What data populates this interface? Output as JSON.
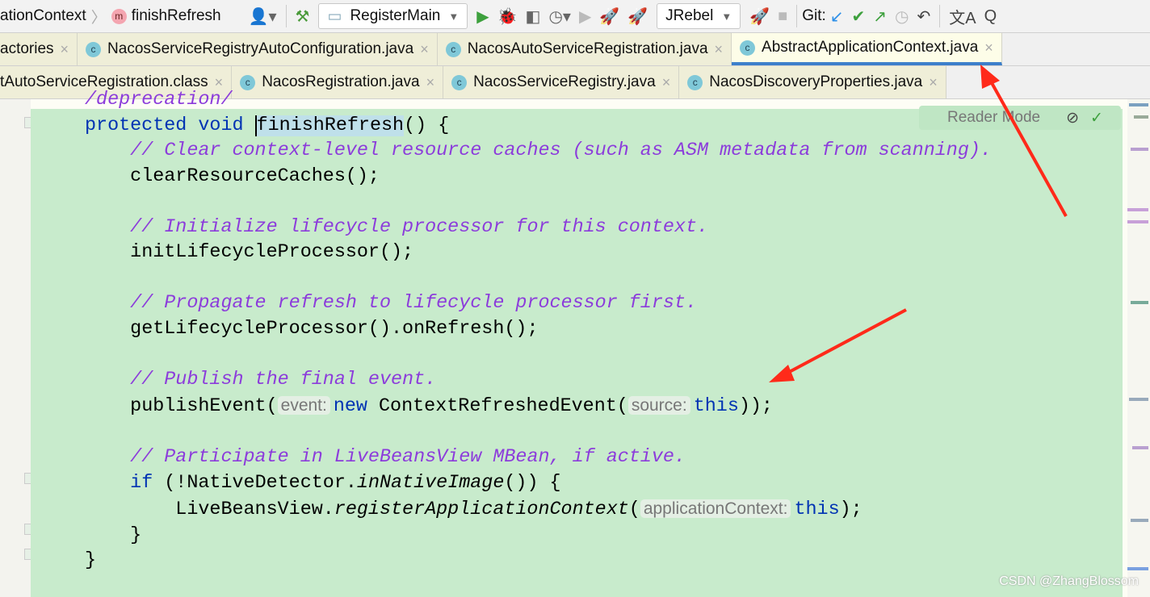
{
  "toolbar": {
    "breadcrumb_class": "ationContext",
    "breadcrumb_method": "finishRefresh",
    "method_icon_letter": "m",
    "run_config": "RegisterMain",
    "jrebel_config": "JRebel",
    "git_label": "Git:"
  },
  "tabs_row1": [
    {
      "label": "actories"
    },
    {
      "label": "NacosServiceRegistryAutoConfiguration.java"
    },
    {
      "label": "NacosAutoServiceRegistration.java"
    },
    {
      "label": "AbstractApplicationContext.java",
      "active": true
    }
  ],
  "tabs_row2": [
    {
      "label": "tAutoServiceRegistration.class"
    },
    {
      "label": "NacosRegistration.java"
    },
    {
      "label": "NacosServiceRegistry.java"
    },
    {
      "label": "NacosDiscoveryProperties.java"
    }
  ],
  "editor": {
    "reader_mode": "Reader Mode",
    "partial_line": "/deprecation/",
    "kw_protected": "protected",
    "kw_void": "void",
    "method_name": "finishRefresh",
    "sig_rest": "() {",
    "c1": "// Clear context-level resource caches (such as ASM metadata from scanning).",
    "l1": "clearResourceCaches();",
    "c2": "// Initialize lifecycle processor for this context.",
    "l2": "initLifecycleProcessor();",
    "c3": "// Propagate refresh to lifecycle processor first.",
    "l3": "getLifecycleProcessor().onRefresh();",
    "c4": "// Publish the final event.",
    "l4a": "publishEvent(",
    "hint_event": "event:",
    "kw_new": "new",
    "l4b": " ContextRefreshedEvent(",
    "hint_source": "source:",
    "kw_this": "this",
    "l4c": "));",
    "c5": "// Participate in LiveBeansView MBean, if active.",
    "kw_if": "if",
    "l5a": " (!NativeDetector.",
    "l5b": "inNativeImage",
    "l5c": "()) {",
    "l6a": "LiveBeansView.",
    "l6b": "registerApplicationContext",
    "l6c": "(",
    "hint_ctx": "applicationContext:",
    "l6d": ");",
    "close_inner": "}",
    "close_outer": "}"
  },
  "watermark": "CSDN @ZhangBlossom",
  "colors": {
    "accent": "#3d7fcb",
    "keyword": "#0033b3",
    "comment": "#8c3cdb",
    "highlight": "#c8ebcc",
    "arrow": "#ff2a1a"
  }
}
